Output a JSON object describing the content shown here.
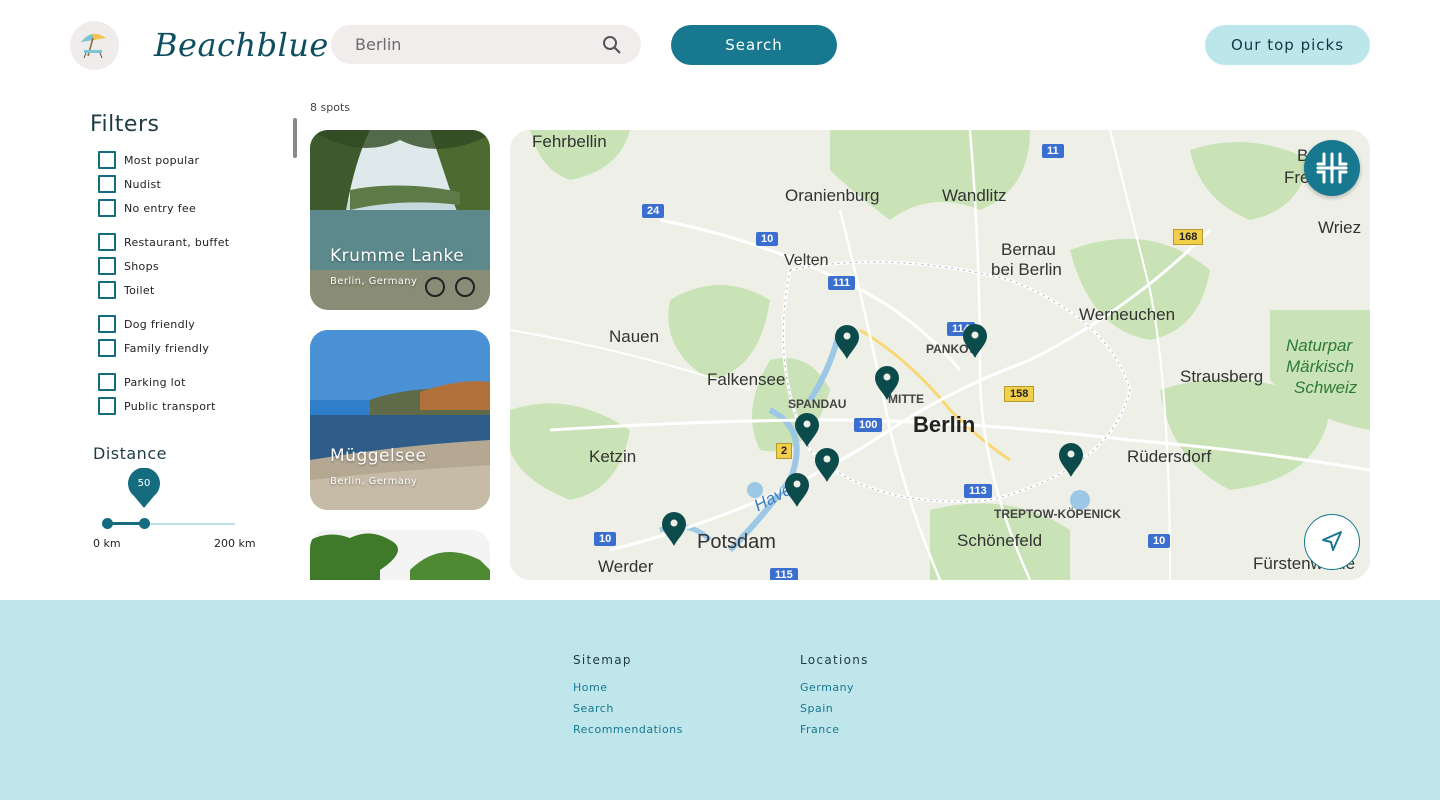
{
  "header": {
    "brand": "Beachblue",
    "search_value": "Berlin",
    "search_button": "Search",
    "top_picks_button": "Our top picks"
  },
  "filters": {
    "title": "Filters",
    "items": [
      "Most popular",
      "Nudist",
      "No entry fee",
      "Restaurant, buffet",
      "Shops",
      "Toilet",
      "Dog friendly",
      "Family friendly",
      "Parking lot",
      "Public transport"
    ],
    "distance": {
      "title": "Distance",
      "value": "50",
      "min_label": "0 km",
      "max_label": "200 km",
      "fraction": 0.25
    }
  },
  "results": {
    "count_label": "8 spots",
    "cards": [
      {
        "title": "Krumme Lanke",
        "subtitle": "Berlin, Germany"
      },
      {
        "title": "Müggelsee",
        "subtitle": "Berlin, Germany"
      },
      {
        "title": "",
        "subtitle": ""
      }
    ]
  },
  "map": {
    "places": {
      "fehrbellin": "Fehrbellin",
      "oranienburg": "Oranienburg",
      "wandlitz": "Wandlitz",
      "velten": "Velten",
      "bernau": "Bernau",
      "bernau2": "bei Berlin",
      "werneuchen": "Werneuchen",
      "nauen": "Nauen",
      "falkensee": "Falkensee",
      "spandau": "SPANDAU",
      "mitte": "MITTE",
      "pankow": "PANKOW",
      "berlin": "Berlin",
      "strausberg": "Strausberg",
      "ketzin": "Ketzin",
      "rudersdorf": "Rüdersdorf",
      "treptow": "TREPTOW-KÖPENICK",
      "potsdam": "Potsdam",
      "schonefeld": "Schönefeld",
      "werder": "Werder",
      "furstenwalde": "Fürstenwalde",
      "wriezen": "Wriez",
      "naturpark1": "Naturpar",
      "naturpark2": "Märkisch",
      "naturpark3": "Schweiz",
      "bad_freienwalde": "B",
      "freien": "Freien",
      "havel": "Havel"
    },
    "roads": {
      "r11": "11",
      "r24": "24",
      "r10a": "10",
      "r111": "111",
      "r168": "168",
      "r114": "114",
      "r158": "158",
      "r100": "100",
      "r2": "2",
      "r113": "113",
      "r10b": "10",
      "r10c": "10",
      "r115": "115"
    }
  },
  "footer": {
    "sitemap": {
      "title": "Sitemap",
      "links": [
        "Home",
        "Search",
        "Recommendations"
      ]
    },
    "locations": {
      "title": "Locations",
      "links": [
        "Germany",
        "Spain",
        "France"
      ]
    }
  },
  "colors": {
    "primary": "#17788f",
    "accent_light": "#bde6ea",
    "footer_bg": "#bfe6ea"
  }
}
